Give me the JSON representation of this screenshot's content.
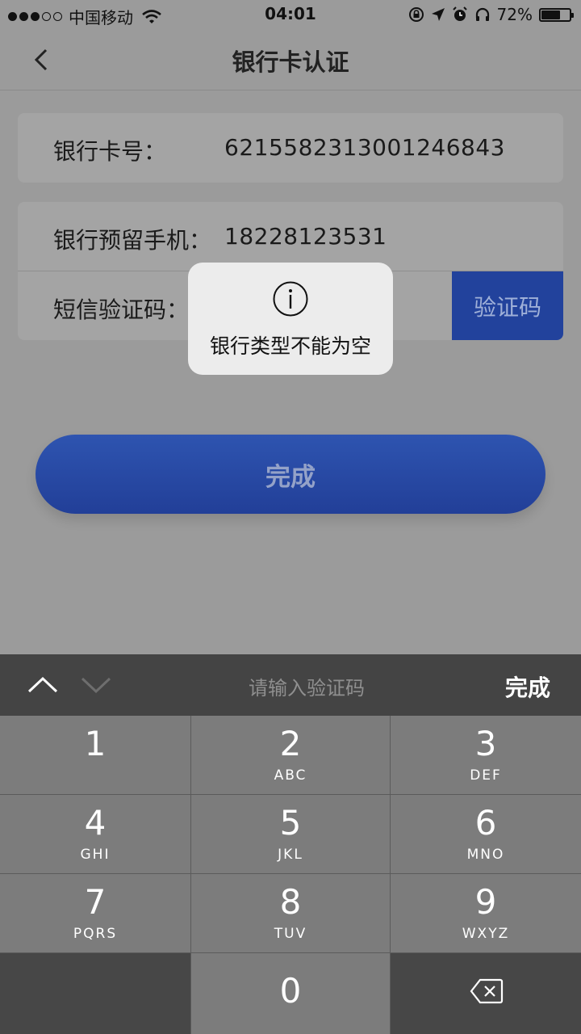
{
  "status_bar": {
    "carrier": "中国移动",
    "time": "04:01",
    "battery": "72%",
    "battery_level": 0.72,
    "signal_bars_filled": 3,
    "signal_bars_total": 5
  },
  "nav": {
    "title": "银行卡认证",
    "back_icon": "chevron-left-icon"
  },
  "form": {
    "card_number_label": "银行卡号：",
    "card_number_value": "6215582313001246843",
    "phone_label": "银行预留手机：",
    "phone_value": "18228123531",
    "sms_label": "短信验证码：",
    "sms_value": "",
    "get_code_button": "验证码"
  },
  "done_button": "完成",
  "toast": {
    "icon": "info-icon",
    "message": "银行类型不能为空"
  },
  "keyboard": {
    "placeholder": "请输入验证码",
    "done_label": "完成",
    "keys": [
      {
        "num": "1",
        "letters": ""
      },
      {
        "num": "2",
        "letters": "ABC"
      },
      {
        "num": "3",
        "letters": "DEF"
      },
      {
        "num": "4",
        "letters": "GHI"
      },
      {
        "num": "5",
        "letters": "JKL"
      },
      {
        "num": "6",
        "letters": "MNO"
      },
      {
        "num": "7",
        "letters": "PQRS"
      },
      {
        "num": "8",
        "letters": "TUV"
      },
      {
        "num": "9",
        "letters": "WXYZ"
      },
      {
        "num": "0",
        "letters": ""
      }
    ]
  },
  "colors": {
    "accent": "#22429c",
    "overlay_background": "#9b9b9b",
    "toast_background": "#ececec",
    "keyboard_key": "#7c7c7c"
  }
}
